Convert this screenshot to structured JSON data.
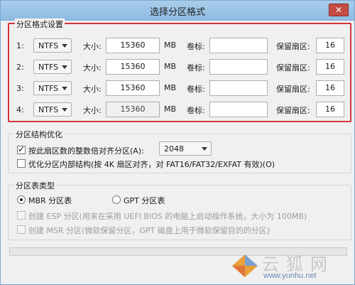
{
  "window": {
    "title": "选择分区格式",
    "close_glyph": "✕"
  },
  "partition_settings": {
    "group_label": "分区格式设置",
    "size_label": "大小:",
    "unit": "MB",
    "volume_label": "卷标:",
    "reserved_label": "保留扇区:",
    "rows": [
      {
        "num": "1:",
        "fs": "NTFS",
        "size": "15360",
        "volume": "",
        "reserved": "16"
      },
      {
        "num": "2:",
        "fs": "NTFS",
        "size": "15360",
        "volume": "",
        "reserved": "16"
      },
      {
        "num": "3:",
        "fs": "NTFS",
        "size": "15360",
        "volume": "",
        "reserved": "16"
      },
      {
        "num": "4:",
        "fs": "NTFS",
        "size": "15360",
        "volume": "",
        "reserved": "16"
      }
    ]
  },
  "structure": {
    "group_label": "分区结构优化",
    "align_label": "按此扇区数的整数倍对齐分区(A):",
    "align_value": "2048",
    "align_checked": true,
    "internal_label": "优化分区内部结构(按 4K 扇区对齐，对 FAT16/FAT32/EXFAT 有效)(O)",
    "internal_checked": false
  },
  "table_type": {
    "group_label": "分区表类型",
    "mbr_label": "MBR 分区表",
    "gpt_label": "GPT 分区表",
    "selected": "mbr",
    "esp_label": "创建 ESP 分区(用来在采用 UEFI BIOS 的电脑上启动操作系统，大小为 100MB)",
    "msr_label": "创建 MSR 分区(微软保留分区，GPT 磁盘上用于微软保留目的的分区)"
  },
  "progress": {
    "fraction": 0
  },
  "watermark": {
    "title": "云狐网",
    "url": "www.yunhu.net"
  },
  "colors": {
    "highlight_border": "#d2363a",
    "titlebar": "#a9cdeb"
  },
  "icons": {
    "dropdown": "chevron-down-icon",
    "close": "close-icon"
  }
}
